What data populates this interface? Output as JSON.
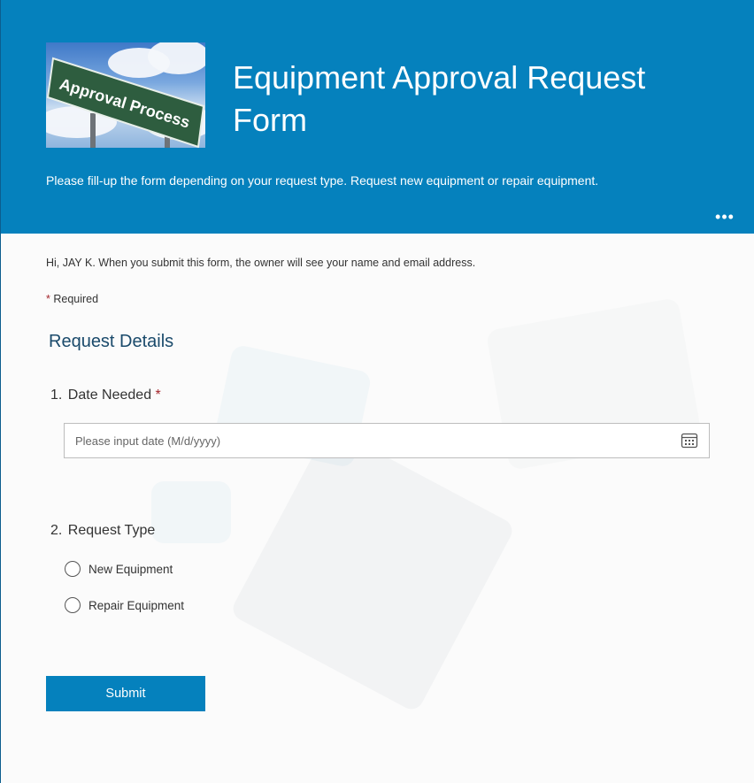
{
  "header": {
    "title": "Equipment Approval Request Form",
    "subtitle": "Please fill-up the form depending on your request type. Request new equipment or repair equipment.",
    "more_icon": "ellipsis-icon",
    "logo_sign_text": "Approval Process",
    "brand_color": "#0581bd"
  },
  "notice": {
    "greeting": "Hi, JAY K. When you submit this form, the owner will see your name and email address.",
    "required_marker": "*",
    "required_label": "Required"
  },
  "section": {
    "title": "Request Details"
  },
  "questions": [
    {
      "number": "1.",
      "title": "Date Needed",
      "required_marker": "*",
      "placeholder": "Please input date (M/d/yyyy)",
      "icon": "calendar-icon"
    },
    {
      "number": "2.",
      "title": "Request Type",
      "options": [
        "New Equipment",
        "Repair Equipment"
      ]
    }
  ],
  "submit_label": "Submit"
}
